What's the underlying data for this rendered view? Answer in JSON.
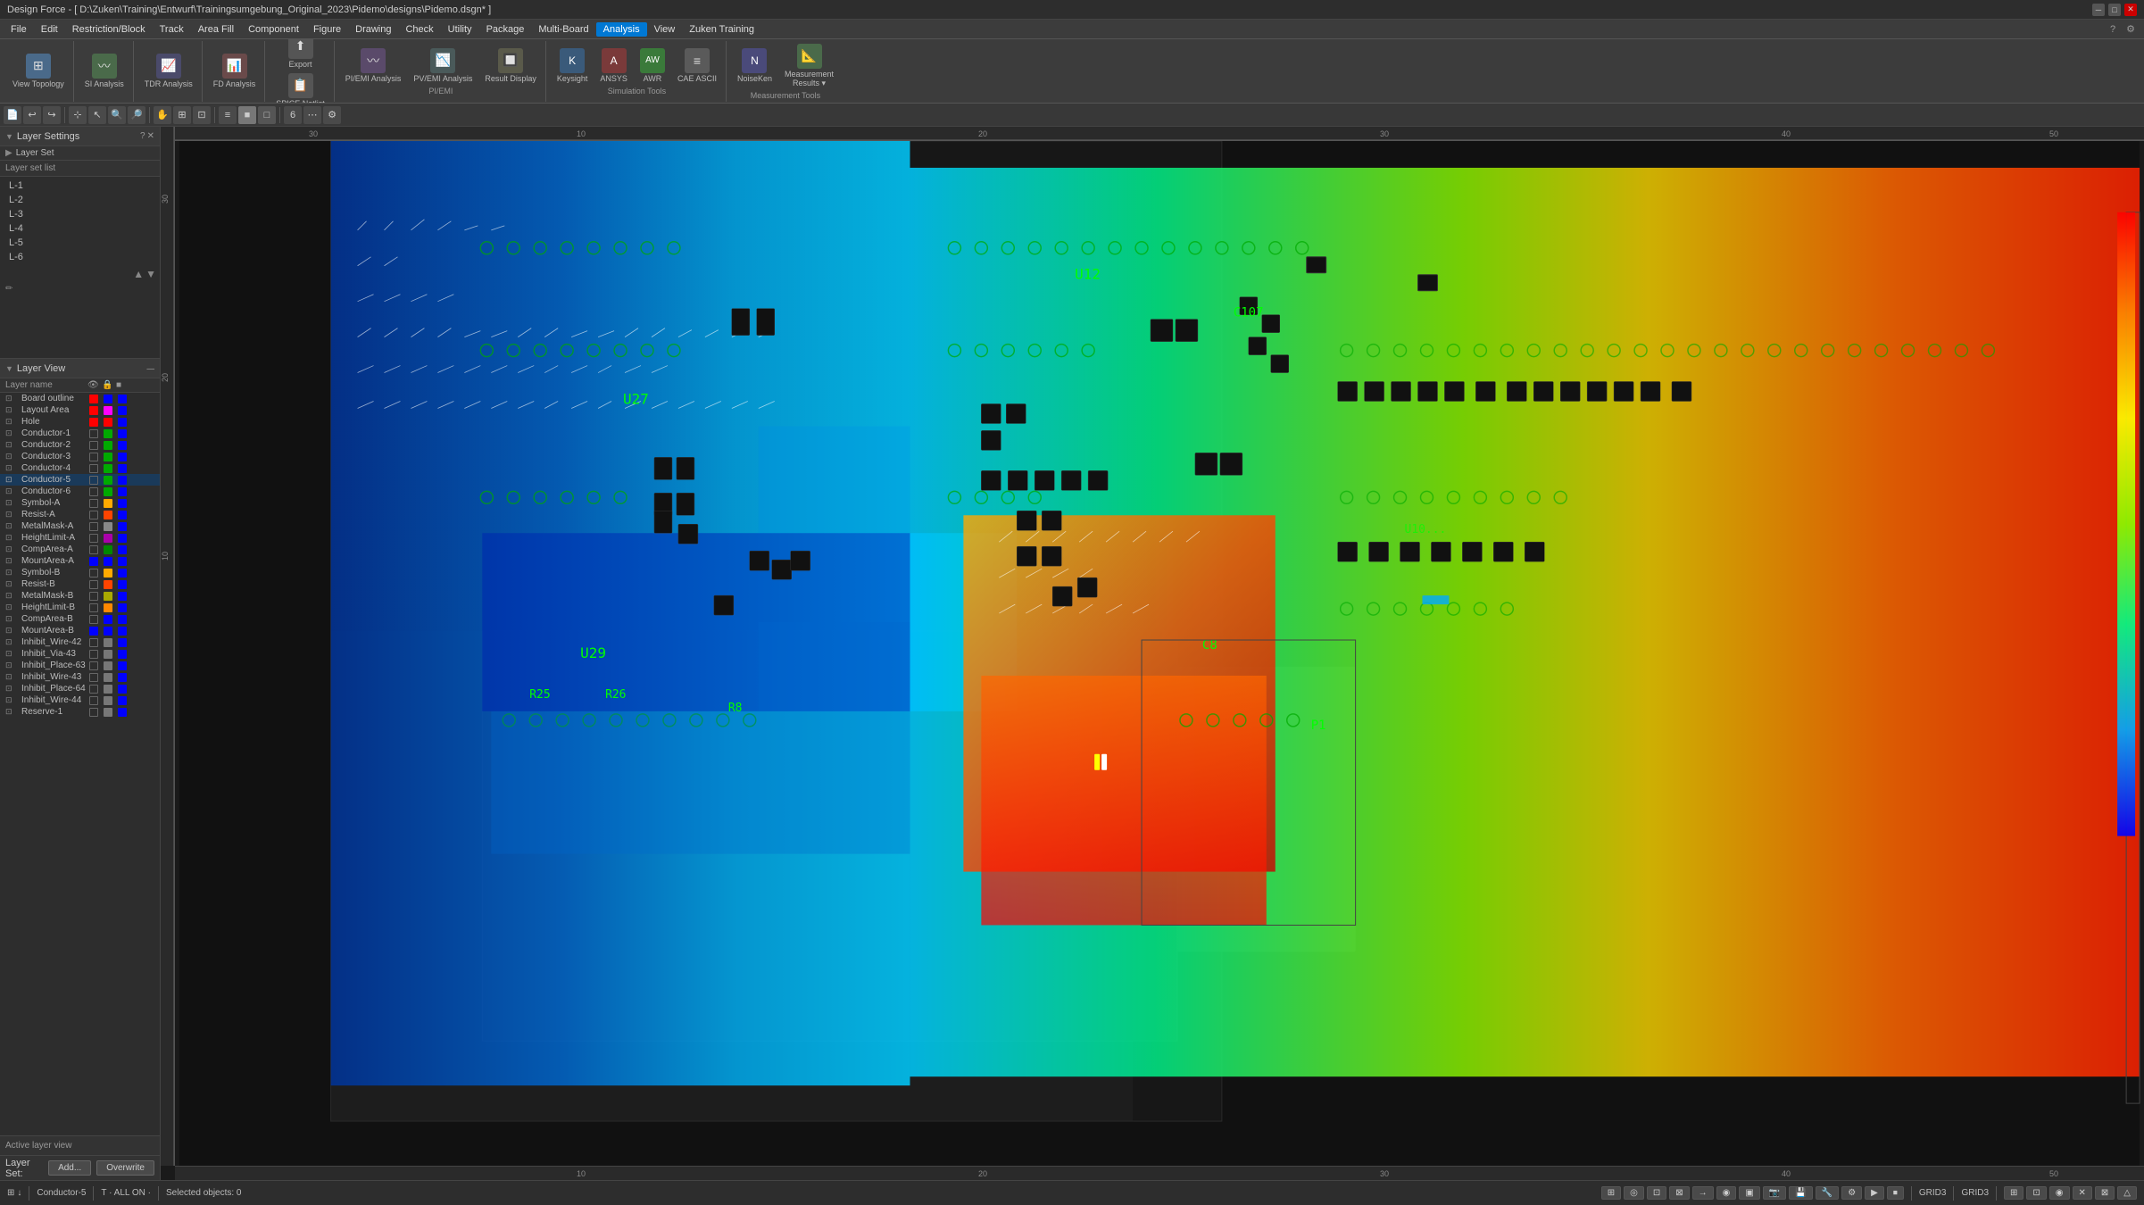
{
  "titlebar": {
    "title": "Design Force - [ D:\\Zuken\\Training\\Entwurf\\Trainingsumgebung_Original_2023\\Pidemo\\designs\\Pidemo.dsgn* ]",
    "minimize": "─",
    "maximize": "□",
    "close": "✕"
  },
  "menubar": {
    "items": [
      "File",
      "Edit",
      "Restriction/Block",
      "Track",
      "Area Fill",
      "Component",
      "Figure",
      "Drawing",
      "Check",
      "Utility",
      "Package",
      "Multi-Board",
      "Analysis",
      "View",
      "Zuken Training"
    ]
  },
  "toolbar": {
    "groups": [
      {
        "id": "view-topology",
        "label": "View Topology",
        "icon": "⊞"
      },
      {
        "id": "si-analysis",
        "label": "SI Analysis",
        "icon": "〰"
      },
      {
        "id": "tdr-analysis",
        "label": "TDR Analysis",
        "icon": "📈"
      },
      {
        "id": "fd-analysis",
        "label": "FD Analysis",
        "icon": "📊"
      },
      {
        "id": "export",
        "label": "Export",
        "icon": "⬆"
      },
      {
        "id": "spice-netlist",
        "label": "SPICE Netlist",
        "icon": "📋"
      },
      {
        "id": "pi-emi-analysis",
        "label": "PI/EMI Analysis",
        "icon": "〰"
      },
      {
        "id": "pv-emi-analysis",
        "label": "PV/EMI Analysis",
        "icon": "📉"
      },
      {
        "id": "result-display",
        "label": "Result Display",
        "icon": "🔲"
      },
      {
        "id": "keysight",
        "label": "Keysight",
        "icon": "K"
      },
      {
        "id": "ansys",
        "label": "ANSYS",
        "icon": "A"
      },
      {
        "id": "awr",
        "label": "AWR",
        "icon": "AW"
      },
      {
        "id": "cae-ascii",
        "label": "CAE ASCII",
        "icon": "≡"
      },
      {
        "id": "noiseken",
        "label": "NoiseKen",
        "icon": "N"
      },
      {
        "id": "measurement-results",
        "label": "Measurement Results ▾",
        "icon": "📐"
      }
    ],
    "group_labels": {
      "pi_emi": "PI/EMI",
      "simulation_tools": "Simulation Tools",
      "measurement_tools": "Measurement Tools"
    }
  },
  "layer_settings": {
    "title": "Layer Settings",
    "layer_set_list_label": "Layer set list",
    "layers": [
      "L-1",
      "L-2",
      "L-3",
      "L-4",
      "L-5",
      "L-6"
    ],
    "add_button": "Add...",
    "overwrite_button": "Overwrite"
  },
  "layer_view": {
    "title": "Layer View",
    "columns": [
      "Layer name",
      "",
      "",
      ""
    ],
    "layers": [
      {
        "name": "Board outline",
        "color1": "#ff0000",
        "color2": "#0000ff",
        "color3": "#0000ff",
        "active": false
      },
      {
        "name": "Layout Area",
        "color1": "#ff0000",
        "color2": "#ff00ff",
        "color3": "#0000ff",
        "active": false
      },
      {
        "name": "Hole",
        "color1": "#ff0000",
        "color2": "#ff0000",
        "color3": "#0000ff",
        "active": false
      },
      {
        "name": "Conductor-1",
        "color1": "#00ff00",
        "color2": "#00ff00",
        "color3": "#0000ff",
        "active": false
      },
      {
        "name": "Conductor-2",
        "color1": "#00ff00",
        "color2": "#00ff00",
        "color3": "#0000ff",
        "active": false
      },
      {
        "name": "Conductor-3",
        "color1": "#00ff00",
        "color2": "#00ff00",
        "color3": "#0000ff",
        "active": false
      },
      {
        "name": "Conductor-4",
        "color1": "#00ff00",
        "color2": "#00ff00",
        "color3": "#0000ff",
        "active": false
      },
      {
        "name": "Conductor-5",
        "color1": "#00ff00",
        "color2": "#00ff00",
        "color3": "#0000ff",
        "active": true
      },
      {
        "name": "Conductor-6",
        "color1": "#00ff00",
        "color2": "#00ff00",
        "color3": "#0000ff",
        "active": false
      },
      {
        "name": "Symbol-A",
        "color1": "#ffff00",
        "color2": "#ffff00",
        "color3": "#0000ff",
        "active": false
      },
      {
        "name": "Resist-A",
        "color1": "#ff8800",
        "color2": "#ff8800",
        "color3": "#0000ff",
        "active": false
      },
      {
        "name": "MetalMask-A",
        "color1": "#888888",
        "color2": "#888888",
        "color3": "#0000ff",
        "active": false
      },
      {
        "name": "HeightLimit-A",
        "color1": "#ff00ff",
        "color2": "#ff00ff",
        "color3": "#0000ff",
        "active": false
      },
      {
        "name": "CompArea-A",
        "color1": "#008800",
        "color2": "#008800",
        "color3": "#0000ff",
        "active": false
      },
      {
        "name": "MountArea-A",
        "color1": "#008888",
        "color2": "#008888",
        "color3": "#0000ff",
        "active": false
      },
      {
        "name": "Symbol-B",
        "color1": "#ffff00",
        "color2": "#ffff00",
        "color3": "#0000ff",
        "active": false
      },
      {
        "name": "Resist-B",
        "color1": "#ff8800",
        "color2": "#ff8800",
        "color3": "#0000ff",
        "active": false
      },
      {
        "name": "MetalMask-B",
        "color1": "#ffff00",
        "color2": "#ffff00",
        "color3": "#0000ff",
        "active": false
      },
      {
        "name": "HeightLimit-B",
        "color1": "#ff8800",
        "color2": "#ff8800",
        "color3": "#0000ff",
        "active": false
      },
      {
        "name": "CompArea-B",
        "color1": "#0000ff",
        "color2": "#0000ff",
        "color3": "#0000ff",
        "active": false
      },
      {
        "name": "MountArea-B",
        "color1": "#0000ff",
        "color2": "#0000ff",
        "color3": "#0000ff",
        "active": false
      },
      {
        "name": "Inhibit_Wire-42",
        "color1": "#888888",
        "color2": "#888888",
        "color3": "#0000ff",
        "active": false
      },
      {
        "name": "Inhibit_Via-43",
        "color1": "#888888",
        "color2": "#888888",
        "color3": "#0000ff",
        "active": false
      },
      {
        "name": "Inhibit_Place-63",
        "color1": "#888888",
        "color2": "#888888",
        "color3": "#0000ff",
        "active": false
      },
      {
        "name": "Inhibit_Wire-43",
        "color1": "#888888",
        "color2": "#888888",
        "color3": "#0000ff",
        "active": false
      },
      {
        "name": "Inhibit_Place-64",
        "color1": "#888888",
        "color2": "#888888",
        "color3": "#0000ff",
        "active": false
      },
      {
        "name": "Inhibit_Wire-44",
        "color1": "#888888",
        "color2": "#888888",
        "color3": "#0000ff",
        "active": false
      },
      {
        "name": "Reserve-1",
        "color1": "#888888",
        "color2": "#888888",
        "color3": "#0000ff",
        "active": false
      }
    ],
    "active_layer_label": "Active layer view",
    "layer_set_label": "Layer Set:"
  },
  "statusbar": {
    "active_layer": "Conductor-5",
    "all_on": "T · ALL ON ·",
    "selected_objects": "Selected objects: 0",
    "grid1": "GRID3",
    "grid2": "GRID3",
    "icons": [
      "⊞",
      "↓",
      "⊡",
      "⊠",
      "→",
      "◎",
      "◉",
      "▦",
      "📷",
      "💾",
      "🔧",
      "⚙",
      "▶",
      "⏹"
    ]
  },
  "pcb": {
    "rulers": {
      "h_ticks": [
        10,
        20,
        30,
        40,
        50
      ],
      "v_ticks": [
        10,
        20,
        30
      ],
      "h_labels": [
        "10",
        "20",
        "30",
        "40",
        "50"
      ],
      "v_labels": [
        "10",
        "20",
        "30"
      ],
      "bottom_labels": [
        "10",
        "20",
        "30",
        "40",
        "50"
      ],
      "left_labels": [
        "30",
        "20",
        "10"
      ]
    },
    "components": [
      "U12",
      "C107",
      "U27",
      "U29",
      "R25",
      "R26",
      "R8",
      "C8",
      "P1"
    ]
  }
}
